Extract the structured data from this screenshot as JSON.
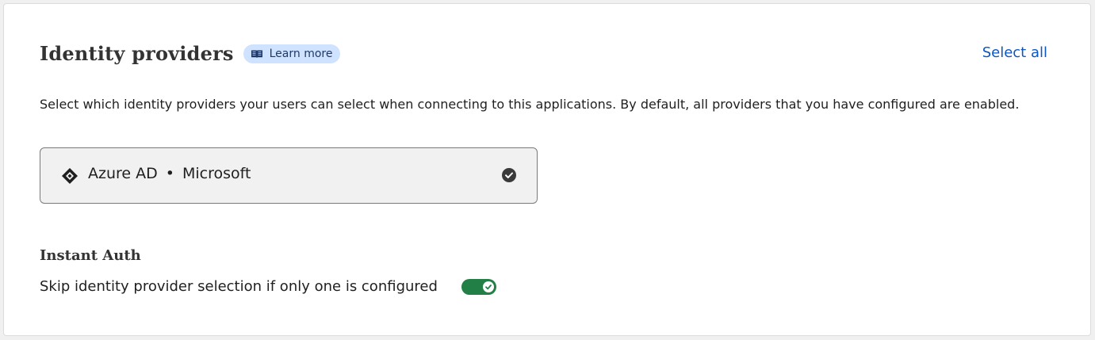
{
  "section": {
    "title": "Identity providers",
    "learn_more_label": "Learn more",
    "select_all_label": "Select all",
    "description": "Select which identity providers your users can select when connecting to this applications. By default, all providers that you have configured are enabled."
  },
  "provider": {
    "name": "Azure AD",
    "separator": "•",
    "type": "Microsoft",
    "icon": "azure-ad-icon",
    "selected": true
  },
  "instant_auth": {
    "title": "Instant Auth",
    "toggle_label": "Skip identity provider selection if only one is configured",
    "enabled": true
  },
  "colors": {
    "accent_link": "#0b57c2",
    "learn_more_bg": "#cfe2ff",
    "toggle_on": "#228047"
  }
}
